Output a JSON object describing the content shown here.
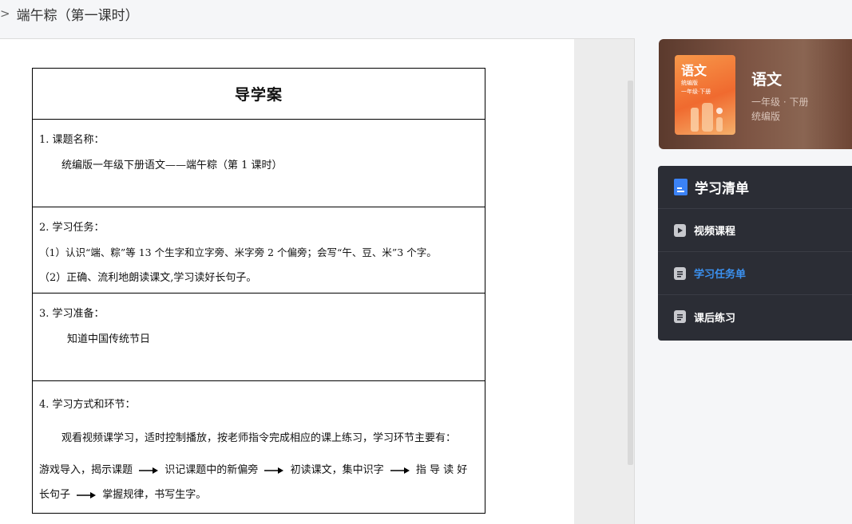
{
  "breadcrumb": {
    "separator": ">",
    "current": "端午粽（第一课时）"
  },
  "document": {
    "title": "导学案",
    "sections": [
      {
        "heading": "1. 课题名称：",
        "lines": [
          "统编版一年级下册语文——端午粽（第 1 课时）"
        ]
      },
      {
        "heading": "2. 学习任务：",
        "lines": [
          "（1）认识“端、粽”等 13 个生字和立字旁、米字旁 2 个偏旁；会写“午、豆、米”3 个字。",
          "（2）正确、流利地朗读课文,学习读好长句子。"
        ]
      },
      {
        "heading": "3. 学习准备：",
        "lines": [
          "知道中国传统节日"
        ]
      },
      {
        "heading": "4. 学习方式和环节：",
        "lines": [
          "观看视频课学习，适时控制播放，按老师指令完成相应的课上练习，学习环节主要有："
        ],
        "flow": [
          "游戏导入，揭示课题",
          "识记课题中的新偏旁",
          "初读课文，集中识字",
          "指 导 读 好",
          "长句子",
          "掌握规律，书写生字。"
        ]
      }
    ]
  },
  "course": {
    "cover_title": "语文",
    "cover_sub1": "统编版",
    "cover_sub2": "一年级·下册",
    "title": "语文",
    "grade": "一年级 · 下册",
    "edition": "统编版"
  },
  "study_list": {
    "title": "学习清单",
    "items": [
      {
        "label": "视频课程",
        "icon": "video-icon",
        "active": false
      },
      {
        "label": "学习任务单",
        "icon": "document-icon",
        "active": true
      },
      {
        "label": "课后练习",
        "icon": "document-icon",
        "active": false
      }
    ]
  },
  "colors": {
    "accent": "#3b91f0",
    "panel_bg": "#2b2d35",
    "cover": "#f06a2f"
  }
}
